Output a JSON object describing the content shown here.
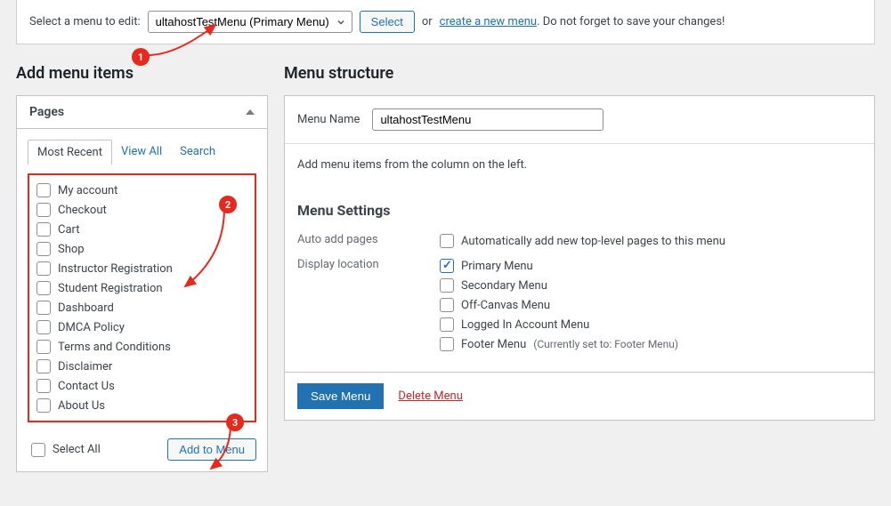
{
  "topbar": {
    "select_label": "Select a menu to edit:",
    "menu_selected": "ultahostTestMenu (Primary Menu)",
    "select_btn": "Select",
    "or": "or",
    "create_link": "create a new menu",
    "reminder": ". Do not forget to save your changes!"
  },
  "left": {
    "heading": "Add menu items",
    "accordion_title": "Pages",
    "tabs": {
      "recent": "Most Recent",
      "all": "View All",
      "search": "Search"
    },
    "pages": [
      "My account",
      "Checkout",
      "Cart",
      "Shop",
      "Instructor Registration",
      "Student Registration",
      "Dashboard",
      "DMCA Policy",
      "Terms and Conditions",
      "Disclaimer",
      "Contact Us",
      "About Us"
    ],
    "select_all": "Select All",
    "add_btn": "Add to Menu"
  },
  "right": {
    "heading": "Menu structure",
    "name_label": "Menu Name",
    "name_value": "ultahostTestMenu",
    "hint": "Add menu items from the column on the left.",
    "settings_heading": "Menu Settings",
    "auto_add_label": "Auto add pages",
    "auto_add_option": "Automatically add new top-level pages to this menu",
    "display_label": "Display location",
    "locations": [
      {
        "label": "Primary Menu",
        "checked": true
      },
      {
        "label": "Secondary Menu",
        "checked": false
      },
      {
        "label": "Off-Canvas Menu",
        "checked": false
      },
      {
        "label": "Logged In Account Menu",
        "checked": false
      },
      {
        "label": "Footer Menu",
        "checked": false,
        "hint": "(Currently set to: Footer Menu)"
      }
    ],
    "save_btn": "Save Menu",
    "delete_link": "Delete Menu"
  },
  "annotations": {
    "b1": "1",
    "b2": "2",
    "b3": "3"
  }
}
